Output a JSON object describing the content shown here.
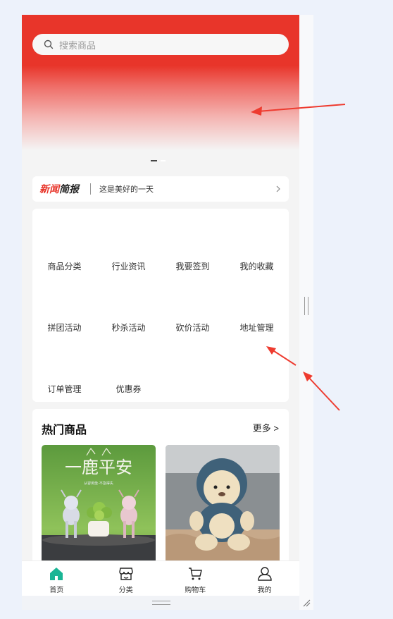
{
  "search": {
    "placeholder": "搜索商品"
  },
  "news": {
    "logo_red": "新闻",
    "logo_dark": "简报",
    "text": "这是美好的一天"
  },
  "menu": {
    "items": [
      {
        "label": "商品分类"
      },
      {
        "label": "行业资讯"
      },
      {
        "label": "我要签到"
      },
      {
        "label": "我的收藏"
      },
      {
        "label": "拼团活动"
      },
      {
        "label": "秒杀活动"
      },
      {
        "label": "砍价活动"
      },
      {
        "label": "地址管理"
      },
      {
        "label": "订单管理"
      },
      {
        "label": "优惠券"
      }
    ]
  },
  "hot": {
    "title": "热门商品",
    "more": "更多 >",
    "products": [
      {
        "image_text": "一鹿平安",
        "image_subtext": "从容闲坐·不急得失"
      },
      {
        "image_text": ""
      }
    ]
  },
  "tabbar": {
    "items": [
      {
        "label": "首页",
        "icon": "home-icon",
        "active": true
      },
      {
        "label": "分类",
        "icon": "shop-icon",
        "active": false
      },
      {
        "label": "购物车",
        "icon": "cart-icon",
        "active": false
      },
      {
        "label": "我的",
        "icon": "user-icon",
        "active": false
      }
    ]
  },
  "colors": {
    "brand_red": "#e8352a",
    "active_tab": "#19b595"
  }
}
